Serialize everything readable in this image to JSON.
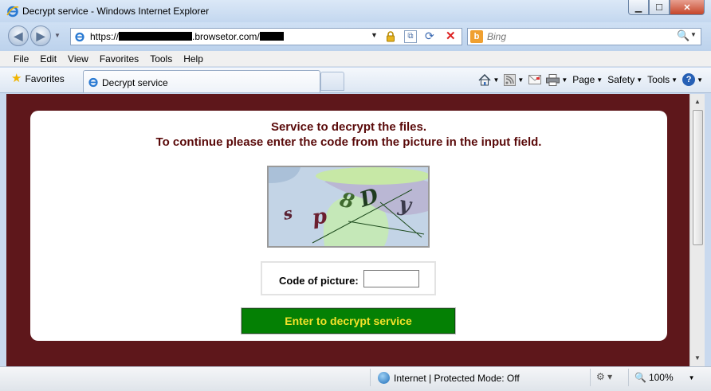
{
  "window": {
    "title": "Decrypt service - Windows Internet Explorer",
    "buttons": {
      "minimize": "▁",
      "maximize": "☐",
      "close": "✕"
    }
  },
  "address_bar": {
    "url_prefix": "https://",
    "url_domain": ".browsetor.com/",
    "icons": [
      "ie-page-icon",
      "lock-icon",
      "compatibility-view-icon",
      "refresh-icon",
      "stop-icon"
    ]
  },
  "search": {
    "placeholder": "Bing",
    "provider_icon": "bing-icon"
  },
  "menu": [
    "File",
    "Edit",
    "View",
    "Favorites",
    "Tools",
    "Help"
  ],
  "favorites_bar": {
    "favorites_label": "Favorites",
    "tab_label": "Decrypt service",
    "commands": {
      "page": "Page",
      "safety": "Safety",
      "tools": "Tools"
    }
  },
  "page": {
    "heading_line1": "Service to decrypt the files.",
    "heading_line2": "To continue please enter the code from the picture in the input field.",
    "captcha_text": "sp8Dy",
    "captcha_chars": [
      "s",
      "p",
      "8",
      "D",
      "y"
    ],
    "code_label": "Code of picture:",
    "code_value": "",
    "submit_label": "Enter to decrypt service",
    "colors": {
      "background": "#5e171b",
      "heading": "#5a0a0a",
      "button": "#048004",
      "button_text": "#f4e22a"
    }
  },
  "status_bar": {
    "zone_text": "Internet | Protected Mode: Off",
    "zoom": "100%"
  }
}
